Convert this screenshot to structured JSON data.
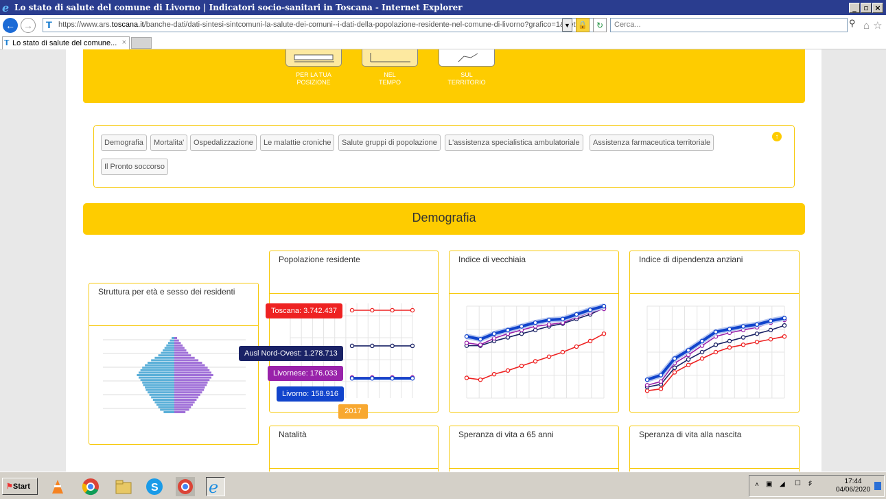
{
  "window": {
    "title": "Lo stato di salute del comune di Livorno | Indicatori socio-sanitari in Toscana - Internet Explorer",
    "minimize": "_",
    "maximize": "▫",
    "close": "×"
  },
  "browser": {
    "url_prefix": "https://www.ars.",
    "url_domain": "toscana.it",
    "url_rest": "/banche-dati/dati-sintesi-sintcomuni-la-salute-dei-comuni--i-dati-della-popolazione-residente-nel-comune-di-livorno?grafico=1&dett",
    "search_placeholder": "Cerca...",
    "tab_title": "Lo stato di salute del comune..."
  },
  "nav_tiles": [
    {
      "line1": "PER LA TUA",
      "line2": "POSIZIONE"
    },
    {
      "line1": "NEL",
      "line2": "TEMPO"
    },
    {
      "line1": "SUL",
      "line2": "TERRITORIO"
    }
  ],
  "menu": {
    "items": [
      "Demografia",
      "Mortalita'",
      "Ospedalizzazione",
      "Le malattie croniche",
      "Salute gruppi di popolazione",
      "L'assistenza specialistica ambulatoriale",
      "Assistenza farmaceutica territoriale",
      "Il Pronto soccorso"
    ]
  },
  "section_title": "Demografia",
  "cards": {
    "struttura": "Struttura per età e sesso dei residenti",
    "popolazione": "Popolazione residente",
    "vecchiaia": "Indice di vecchiaia",
    "dipendenza": "Indice di dipendenza anziani",
    "natalita": "Natalità",
    "speranza65": "Speranza di vita a 65 anni",
    "speranza_nascita": "Speranza di vita alla nascita"
  },
  "tooltips": {
    "toscana": "Toscana: 3.742.437",
    "ausl": "Ausl Nord-Ovest: 1.278.713",
    "livornese": "Livornese: 176.033",
    "livorno": "Livorno: 158.916",
    "year": "2017"
  },
  "colors": {
    "toscana": "#ee2222",
    "ausl": "#1a2266",
    "livornese": "#9922aa",
    "livorno": "#1144cc",
    "yellow": "#fecc00",
    "male": "#5aafd8",
    "female": "#a070d8"
  },
  "taskbar": {
    "start": "Start",
    "time": "17:44",
    "date": "04/06/2020"
  },
  "chart_data": [
    {
      "type": "line",
      "title": "Popolazione residente",
      "series": [
        {
          "name": "Toscana",
          "values": [
            3742437,
            3742437,
            3742437,
            3742437
          ]
        },
        {
          "name": "Ausl Nord-Ovest",
          "values": [
            1278713,
            1278713,
            1278713,
            1278713
          ]
        },
        {
          "name": "Livornese",
          "values": [
            176033,
            176033,
            176033,
            176033
          ]
        },
        {
          "name": "Livorno",
          "values": [
            158916,
            158916,
            158916,
            158916
          ]
        }
      ],
      "highlight": "2017"
    },
    {
      "type": "line",
      "title": "Indice di vecchiaia",
      "series": [
        {
          "name": "Livorno",
          "values": [
            0.67,
            0.64,
            0.7,
            0.74,
            0.78,
            0.82,
            0.85,
            0.86,
            0.91,
            0.96,
            1.0
          ]
        },
        {
          "name": "Livornese",
          "values": [
            0.6,
            0.58,
            0.65,
            0.7,
            0.74,
            0.78,
            0.8,
            0.82,
            0.88,
            0.93,
            0.97
          ]
        },
        {
          "name": "Ausl Nord-Ovest",
          "values": [
            0.57,
            0.57,
            0.62,
            0.66,
            0.7,
            0.74,
            0.78,
            0.81,
            0.86,
            0.91,
            0.98
          ]
        },
        {
          "name": "Toscana",
          "values": [
            0.22,
            0.2,
            0.26,
            0.3,
            0.35,
            0.4,
            0.45,
            0.5,
            0.56,
            0.62,
            0.7
          ]
        }
      ]
    },
    {
      "type": "line",
      "title": "Indice di dipendenza anziani",
      "series": [
        {
          "name": "Livorno",
          "values": [
            0.2,
            0.25,
            0.43,
            0.52,
            0.62,
            0.72,
            0.75,
            0.78,
            0.8,
            0.84,
            0.87
          ]
        },
        {
          "name": "Livornese",
          "values": [
            0.14,
            0.18,
            0.38,
            0.47,
            0.57,
            0.67,
            0.71,
            0.74,
            0.77,
            0.82,
            0.85
          ]
        },
        {
          "name": "Ausl Nord-Ovest",
          "values": [
            0.12,
            0.15,
            0.33,
            0.42,
            0.5,
            0.58,
            0.62,
            0.66,
            0.7,
            0.74,
            0.79
          ]
        },
        {
          "name": "Toscana",
          "values": [
            0.08,
            0.1,
            0.28,
            0.36,
            0.43,
            0.5,
            0.55,
            0.58,
            0.61,
            0.64,
            0.67
          ]
        }
      ]
    }
  ]
}
